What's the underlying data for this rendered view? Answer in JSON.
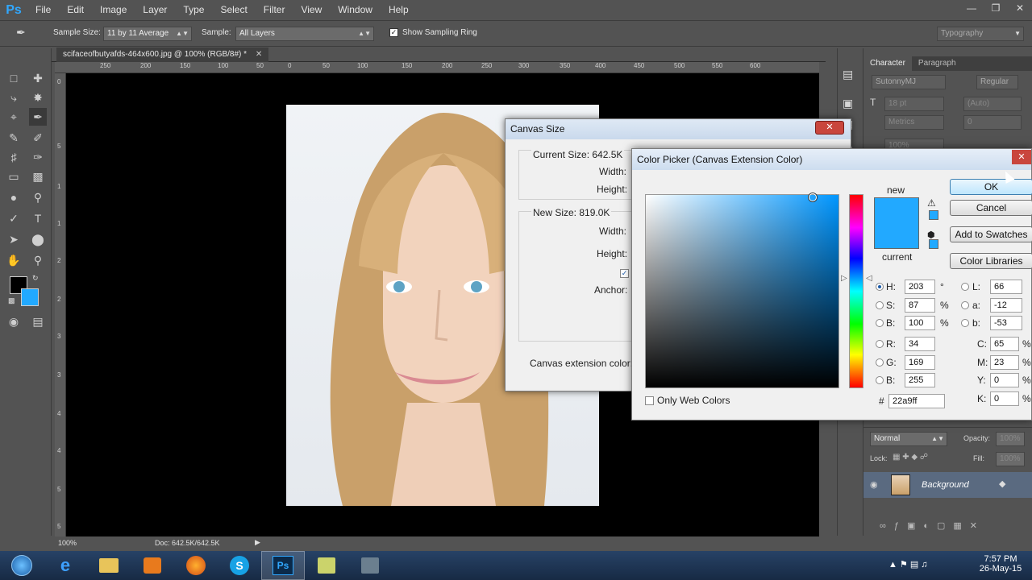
{
  "app": {
    "logo": "Ps"
  },
  "menu": [
    "File",
    "Edit",
    "Image",
    "Layer",
    "Type",
    "Select",
    "Filter",
    "View",
    "Window",
    "Help"
  ],
  "options": {
    "sample_size_label": "Sample Size:",
    "sample_size_value": "11 by 11 Average",
    "sample_label": "Sample:",
    "sample_value": "All Layers",
    "sampling_ring": "Show Sampling Ring",
    "workspace": "Typography"
  },
  "document": {
    "tab": "scifaceofbutyafds-464x600.jpg @ 100% (RGB/8#) *",
    "ruler_h": [
      "0",
      "50",
      "100",
      "150",
      "200",
      "250",
      "300",
      "350",
      "400",
      "450",
      "500",
      "550",
      "600"
    ],
    "ruler_h_neg": [
      "250",
      "200",
      "150",
      "100",
      "50"
    ],
    "ruler_v": [
      "0",
      "5",
      "1",
      "1",
      "2",
      "2",
      "3",
      "3",
      "4",
      "4",
      "5",
      "5"
    ],
    "zoom": "100%",
    "doc_size": "Doc: 642.5K/642.5K"
  },
  "panel": {
    "tab_character": "Character",
    "tab_paragraph": "Paragraph",
    "font_family": "SutonnyMJ",
    "font_style": "Regular",
    "font_size": "18 pt",
    "leading": "(Auto)",
    "kerning": "Metrics",
    "tracking": "0",
    "scale": "100%",
    "blend_mode": "Normal",
    "opacity_label": "Opacity:",
    "opacity": "100%",
    "lock_label": "Lock:",
    "fill_label": "Fill:",
    "fill": "100%",
    "layer_name": "Background"
  },
  "canvas_size": {
    "title": "Canvas Size",
    "current_size": "Current Size: 642.5K",
    "width_label": "Width:",
    "height_label": "Height:",
    "new_size": "New Size: 819.0K",
    "anchor_label": "Anchor:",
    "extension_label": "Canvas extension color:",
    "close": "✕"
  },
  "color_picker": {
    "title": "Color Picker (Canvas Extension Color)",
    "new_label": "new",
    "current_label": "current",
    "ok": "OK",
    "cancel": "Cancel",
    "add_swatches": "Add to Swatches",
    "color_libraries": "Color Libraries",
    "only_web": "Only Web Colors",
    "H": "203",
    "S": "87",
    "B": "100",
    "R": "34",
    "G": "169",
    "Bv": "255",
    "L": "66",
    "a": "-12",
    "b": "-53",
    "C": "65",
    "M": "23",
    "Y": "0",
    "K": "0",
    "hex": "22a9ff",
    "deg": "°",
    "pct": "%",
    "labels": {
      "H": "H:",
      "S": "S:",
      "B": "B:",
      "R": "R:",
      "G": "G:",
      "Bv": "B:",
      "L": "L:",
      "a": "a:",
      "b": "b:",
      "C": "C:",
      "M": "M:",
      "Y": "Y:",
      "K": "K:",
      "hash": "#"
    }
  },
  "colors": {
    "accent": "#22a9ff",
    "fg": "#000000",
    "bg": "#22a9ff"
  },
  "clock": {
    "time": "7:57 PM",
    "date": "26-May-15"
  }
}
